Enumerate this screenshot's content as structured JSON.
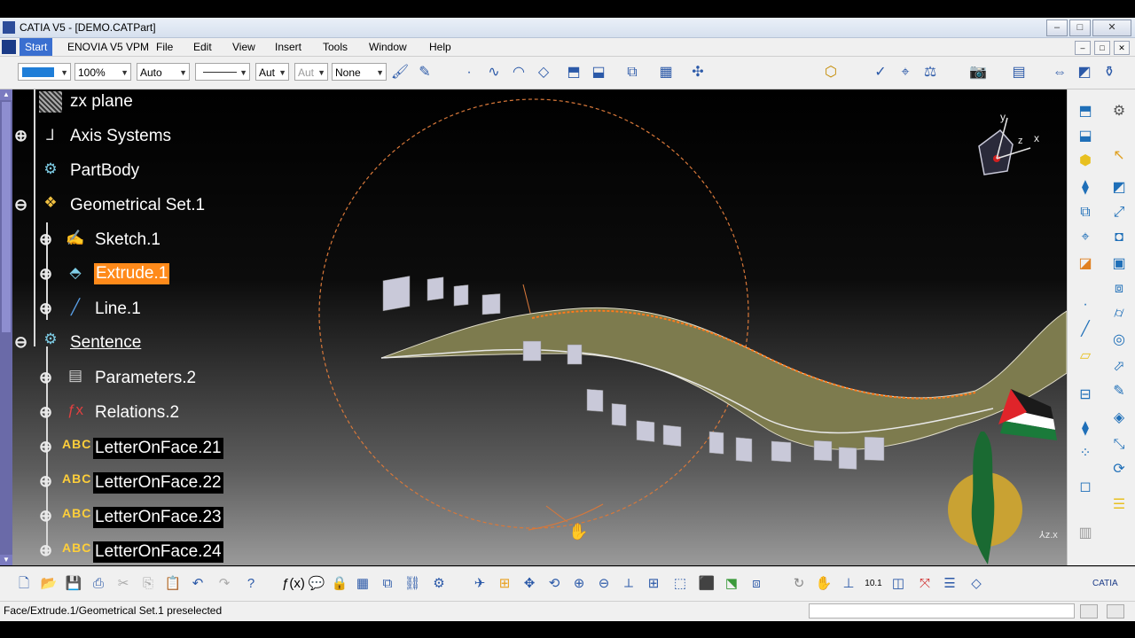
{
  "window": {
    "title": "CATIA V5 - [DEMO.CATPart]",
    "buttons": [
      "–",
      "□",
      "✕"
    ]
  },
  "menu": {
    "items": [
      "Start",
      "ENOVIA V5 VPM",
      "File",
      "Edit",
      "View",
      "Insert",
      "Tools",
      "Window",
      "Help"
    ],
    "doc_buttons": [
      "–",
      "□",
      "✕"
    ]
  },
  "toolbar_top": {
    "color_value": "",
    "transparency_value": "100%",
    "line_thickness_value": "Auto",
    "line_type_value": "",
    "point_symbol_value": "Aut",
    "point_symbol2_value": "Aut",
    "layer_value": "None",
    "accent_color": "#1f7ed8"
  },
  "tree": {
    "items": [
      {
        "label": "zx plane",
        "icon": "plane-icon"
      },
      {
        "label": "Axis Systems",
        "icon": "axis-system-icon"
      },
      {
        "label": "PartBody",
        "icon": "partbody-icon"
      },
      {
        "label": "Geometrical Set.1",
        "icon": "geometrical-set-icon"
      },
      {
        "label": "Sketch.1",
        "icon": "sketch-icon"
      },
      {
        "label": "Extrude.1",
        "icon": "extrude-icon"
      },
      {
        "label": "Line.1",
        "icon": "line-icon"
      },
      {
        "label": "Sentence",
        "icon": "sentence-icon"
      },
      {
        "label": "Parameters.2",
        "icon": "parameters-icon"
      },
      {
        "label": "Relations.2",
        "icon": "relations-icon"
      },
      {
        "label": "LetterOnFace.21",
        "icon": "abc-icon"
      },
      {
        "label": "LetterOnFace.22",
        "icon": "abc-icon"
      },
      {
        "label": "LetterOnFace.23",
        "icon": "abc-icon"
      },
      {
        "label": "LetterOnFace.24",
        "icon": "abc-icon"
      }
    ],
    "abc_text": "ABC",
    "selected_color": "#ff8a1a"
  },
  "compass": {
    "x": "x",
    "y": "y",
    "z": "z"
  },
  "status": {
    "text": "Face/Extrude.1/Geometrical Set.1 preselected"
  },
  "colors": {
    "surface": "#7d7b4e",
    "circle": "#d8783a",
    "flag_red": "#e0242a",
    "flag_green": "#1a7a3a",
    "emblem_gold": "#c9a233"
  }
}
